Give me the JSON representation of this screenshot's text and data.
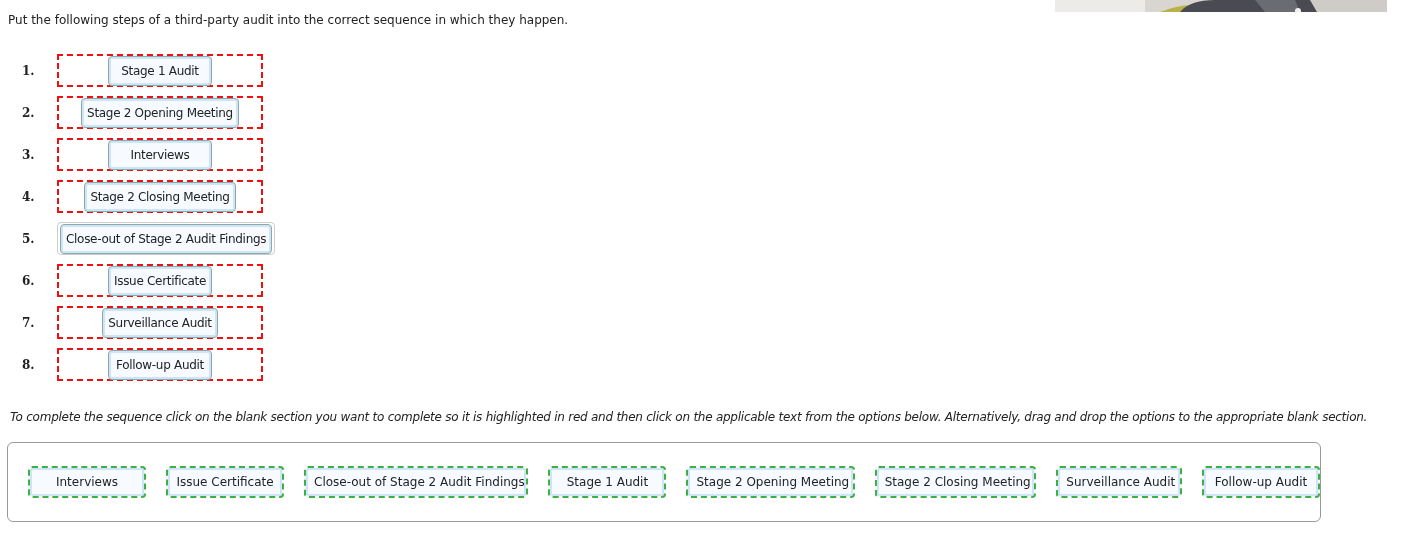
{
  "question": "Put the following steps of a third-party audit into the correct sequence in which they happen.",
  "sequence": [
    {
      "number": "1.",
      "answer": "Stage 1 Audit",
      "highlighted": true
    },
    {
      "number": "2.",
      "answer": "Stage 2 Opening Meeting",
      "highlighted": true
    },
    {
      "number": "3.",
      "answer": "Interviews",
      "highlighted": true
    },
    {
      "number": "4.",
      "answer": "Stage 2 Closing Meeting",
      "highlighted": true
    },
    {
      "number": "5.",
      "answer": "Close-out of Stage 2 Audit Findings",
      "highlighted": false
    },
    {
      "number": "6.",
      "answer": "Issue Certificate",
      "highlighted": true
    },
    {
      "number": "7.",
      "answer": "Surveillance Audit",
      "highlighted": true
    },
    {
      "number": "8.",
      "answer": "Follow-up Audit",
      "highlighted": true
    }
  ],
  "instructions": "To complete the sequence click on the blank section you want to complete so it is highlighted in red and then click on the applicable text from the options below. Alternatively, drag and drop the options to the appropriate blank section.",
  "options": [
    "Interviews",
    "Issue Certificate",
    "Close-out of Stage 2 Audit Findings",
    "Stage 1 Audit",
    "Stage 2 Opening Meeting",
    "Stage 2 Closing Meeting",
    "Surveillance Audit",
    "Follow-up Audit"
  ]
}
